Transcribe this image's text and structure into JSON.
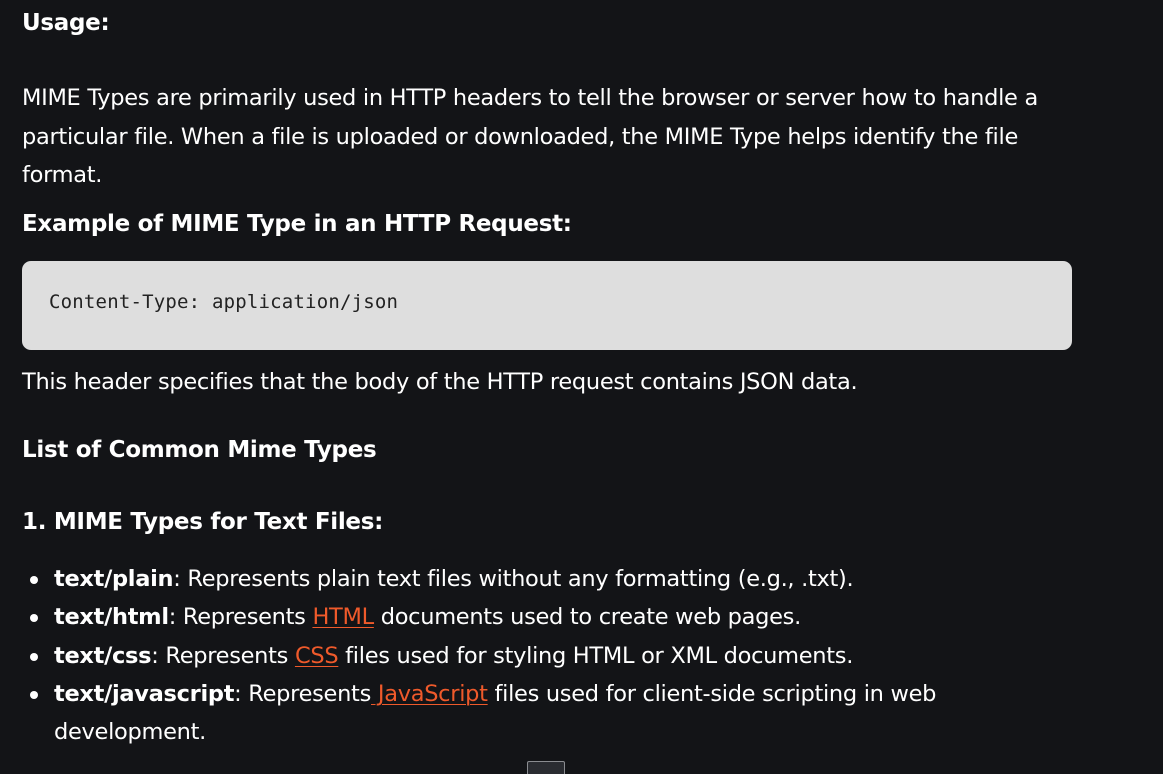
{
  "usage": {
    "heading": "Usage:",
    "paragraph": "MIME Types are primarily used in HTTP headers to tell the browser or server how to handle a particular file. When a file is uploaded or downloaded, the MIME Type helps identify the file format."
  },
  "example": {
    "heading": "Example of MIME Type in an HTTP Request:",
    "code": "Content-Type: application/json",
    "explanation": "This header specifies that the body of the HTTP request contains JSON data."
  },
  "common_list": {
    "heading": "List of Common Mime Types"
  },
  "text_files": {
    "heading": "1. MIME Types for Text Files:",
    "items": [
      {
        "term": "text/plain",
        "before": ": Represents plain text files without any formatting (e.g., .txt).",
        "link": "",
        "after": ""
      },
      {
        "term": "text/html",
        "before": ": Represents ",
        "link": "HTML",
        "after": " documents used to create web pages."
      },
      {
        "term": "text/css",
        "before": ": Represents ",
        "link": "CSS",
        "after": " files used for styling HTML or XML documents."
      },
      {
        "term": "text/javascript",
        "before": ": Represents",
        "link": " JavaScript",
        "after": " files used for client-side scripting in web development."
      }
    ]
  },
  "colors": {
    "background": "#131417",
    "text": "#ffffff",
    "code_background": "#dedede",
    "link": "#ef5a2b"
  }
}
